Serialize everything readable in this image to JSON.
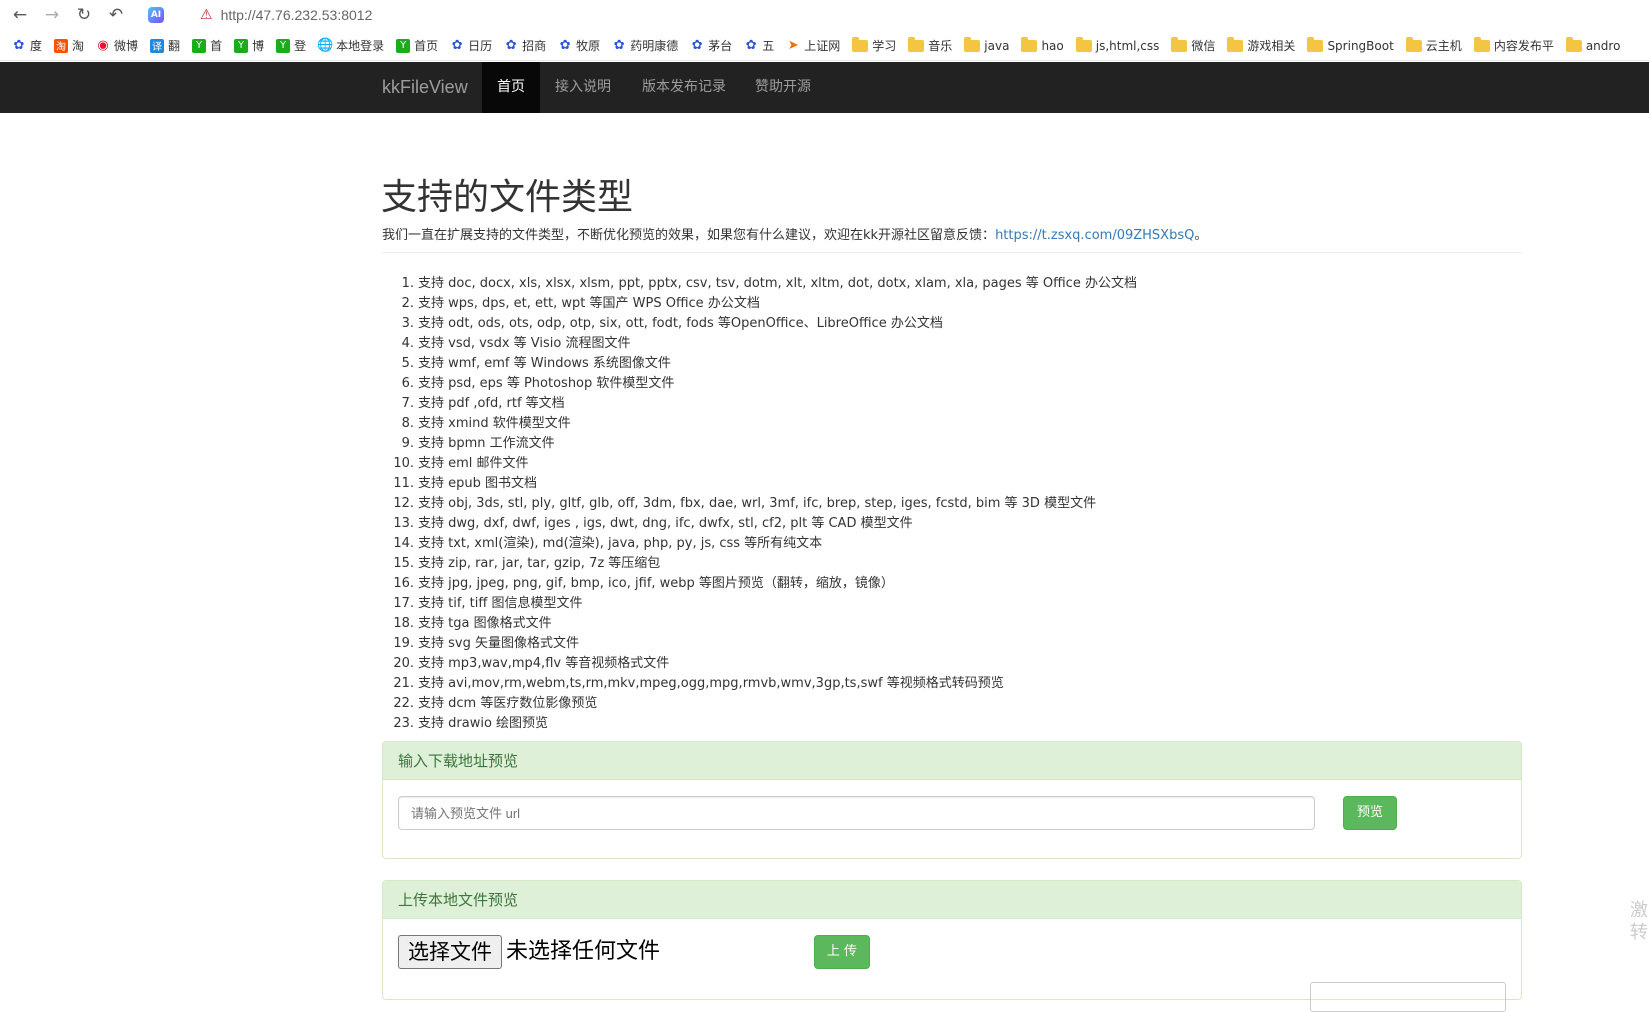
{
  "browser": {
    "url": "http://47.76.232.53:8012",
    "bookmarks": [
      {
        "icon": "paw",
        "label": "度"
      },
      {
        "icon": "taobao",
        "label": "淘"
      },
      {
        "icon": "weibo",
        "label": "微博"
      },
      {
        "icon": "trans",
        "label": "翻"
      },
      {
        "icon": "y",
        "label": "首"
      },
      {
        "icon": "y",
        "label": "博"
      },
      {
        "icon": "y",
        "label": "登"
      },
      {
        "icon": "globe",
        "label": "本地登录"
      },
      {
        "icon": "y",
        "label": "首页"
      },
      {
        "icon": "paw",
        "label": "日历"
      },
      {
        "icon": "paw",
        "label": "招商"
      },
      {
        "icon": "paw",
        "label": "牧原"
      },
      {
        "icon": "paw",
        "label": "药明康德"
      },
      {
        "icon": "paw",
        "label": "茅台"
      },
      {
        "icon": "paw",
        "label": "五"
      },
      {
        "icon": "arrow",
        "label": "上证网"
      },
      {
        "icon": "folder",
        "label": "学习"
      },
      {
        "icon": "folder",
        "label": "音乐"
      },
      {
        "icon": "folder",
        "label": "java"
      },
      {
        "icon": "folder",
        "label": "hao"
      },
      {
        "icon": "folder",
        "label": "js,html,css"
      },
      {
        "icon": "folder",
        "label": "微信"
      },
      {
        "icon": "folder",
        "label": "游戏相关"
      },
      {
        "icon": "folder",
        "label": "SpringBoot"
      },
      {
        "icon": "folder",
        "label": "云主机"
      },
      {
        "icon": "folder",
        "label": "内容发布平"
      },
      {
        "icon": "folder",
        "label": "andro"
      }
    ]
  },
  "navbar": {
    "brand": "kkFileView",
    "items": [
      "首页",
      "接入说明",
      "版本发布记录",
      "赞助开源"
    ]
  },
  "main": {
    "title": "支持的文件类型",
    "lead_text": "我们一直在扩展支持的文件类型，不断优化预览的效果，如果您有什么建议，欢迎在kk开源社区留意反馈：",
    "lead_link": "https://t.zsxq.com/09ZHSXbsQ",
    "lead_end": "。",
    "types": [
      "支持 doc, docx, xls, xlsx, xlsm, ppt, pptx, csv, tsv, dotm, xlt, xltm, dot, dotx, xlam, xla, pages 等 Office 办公文档",
      "支持 wps, dps, et, ett, wpt 等国产 WPS Office 办公文档",
      "支持 odt, ods, ots, odp, otp, six, ott, fodt, fods 等OpenOffice、LibreOffice 办公文档",
      "支持 vsd, vsdx 等 Visio 流程图文件",
      "支持 wmf, emf 等 Windows 系统图像文件",
      "支持 psd, eps 等 Photoshop 软件模型文件",
      "支持 pdf ,ofd, rtf 等文档",
      "支持 xmind 软件模型文件",
      "支持 bpmn 工作流文件",
      "支持 eml 邮件文件",
      "支持 epub 图书文档",
      "支持 obj, 3ds, stl, ply, gltf, glb, off, 3dm, fbx, dae, wrl, 3mf, ifc, brep, step, iges, fcstd, bim 等 3D 模型文件",
      "支持 dwg, dxf, dwf, iges , igs, dwt, dng, ifc, dwfx, stl, cf2, plt 等 CAD 模型文件",
      "支持 txt, xml(渲染), md(渲染), java, php, py, js, css 等所有纯文本",
      "支持 zip, rar, jar, tar, gzip, 7z 等压缩包",
      "支持 jpg, jpeg, png, gif, bmp, ico, jfif, webp 等图片预览（翻转，缩放，镜像）",
      "支持 tif, tiff 图信息模型文件",
      "支持 tga 图像格式文件",
      "支持 svg 矢量图像格式文件",
      "支持 mp3,wav,mp4,flv 等音视频格式文件",
      "支持 avi,mov,rm,webm,ts,rm,mkv,mpeg,ogg,mpg,rmvb,wmv,3gp,ts,swf 等视频格式转码预览",
      "支持 dcm 等医疗数位影像预览",
      "支持 drawio 绘图预览"
    ]
  },
  "url_panel": {
    "heading": "输入下载地址预览",
    "placeholder": "请输入预览文件 url",
    "button": "预览"
  },
  "upload_panel": {
    "heading": "上传本地文件预览",
    "choose_button": "选择文件",
    "no_file": "未选择任何文件",
    "upload_button": "上 传"
  },
  "side_text": "激\n转"
}
